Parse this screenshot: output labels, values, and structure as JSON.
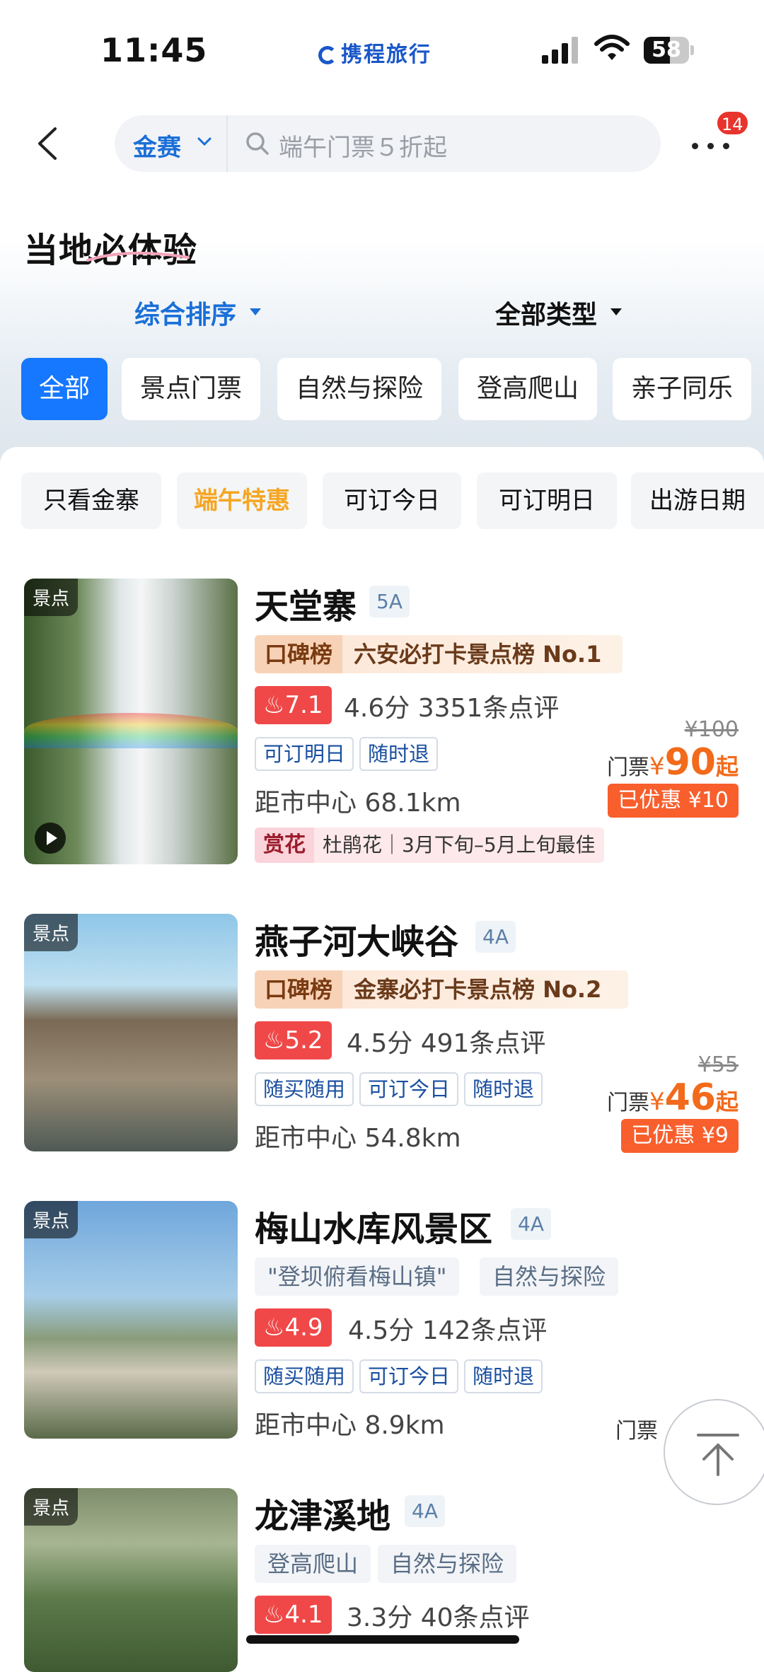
{
  "status_bar": {
    "time": "11:45",
    "brand": "携程旅行",
    "battery": "58",
    "battery_level": 0.58
  },
  "nav": {
    "city": "金赛",
    "search_placeholder": "端午门票５折起",
    "badge_count": "14"
  },
  "page_title": "当地必体验",
  "sort": {
    "sort_label": "综合排序",
    "type_label": "全部类型"
  },
  "categories": [
    {
      "label": "全部",
      "active": true
    },
    {
      "label": "景点门票",
      "active": false
    },
    {
      "label": "自然与探险",
      "active": false
    },
    {
      "label": "登高爬山",
      "active": false
    },
    {
      "label": "亲子同乐",
      "active": false
    }
  ],
  "filters": [
    {
      "label": "只看金寨"
    },
    {
      "label": "端午特惠",
      "highlight": true
    },
    {
      "label": "可订今日"
    },
    {
      "label": "可订明日"
    },
    {
      "label": "出游日期"
    }
  ],
  "icons": {
    "back": "back-arrow-icon",
    "search": "search-icon",
    "more": "more-icon",
    "top": "back-to-top-icon",
    "play": "play-icon",
    "flame": "flame-icon"
  },
  "colors": {
    "accent": "#1677ff",
    "price": "#f26a1b",
    "score": "#f04848"
  },
  "cards": [
    {
      "thumb_tag": "景点",
      "name": "天堂寨",
      "level": "5A",
      "rank_label": "口碑榜",
      "rank_text": "六安必打卡景点榜 No.1",
      "score": "7.1",
      "rating": "4.6分  3351条点评",
      "tags": [
        "可订明日",
        "随时退"
      ],
      "distance": "距市中心 68.1km",
      "flower_label": "赏花",
      "flower_text": "杜鹃花｜3月下旬–5月上旬最佳",
      "orig_price": "¥100",
      "price_prefix": "门票",
      "price_symbol": "¥",
      "price": "90",
      "price_suffix": "起",
      "discount": "已优惠 ¥10"
    },
    {
      "thumb_tag": "景点",
      "name": "燕子河大峡谷",
      "level": "4A",
      "rank_label": "口碑榜",
      "rank_text": "金寨必打卡景点榜 No.2",
      "score": "5.2",
      "rating": "4.5分  491条点评",
      "tags": [
        "随买随用",
        "可订今日",
        "随时退"
      ],
      "distance": "距市中心 54.8km",
      "orig_price": "¥55",
      "price_prefix": "门票",
      "price_symbol": "¥",
      "price": "46",
      "price_suffix": "起",
      "discount": "已优惠 ¥9"
    },
    {
      "thumb_tag": "景点",
      "name": "梅山水库风景区",
      "level": "4A",
      "themes": [
        "\"登坝俯看梅山镇\"",
        "自然与探险"
      ],
      "score": "4.9",
      "rating": "4.5分  142条点评",
      "tags": [
        "随买随用",
        "可订今日",
        "随时退"
      ],
      "distance": "距市中心 8.9km",
      "price_prefix": "门票"
    },
    {
      "thumb_tag": "景点",
      "name": "龙津溪地",
      "level": "4A",
      "themes": [
        "登高爬山",
        "自然与探险"
      ],
      "score": "4.1",
      "rating": "3.3分  40条点评"
    }
  ]
}
